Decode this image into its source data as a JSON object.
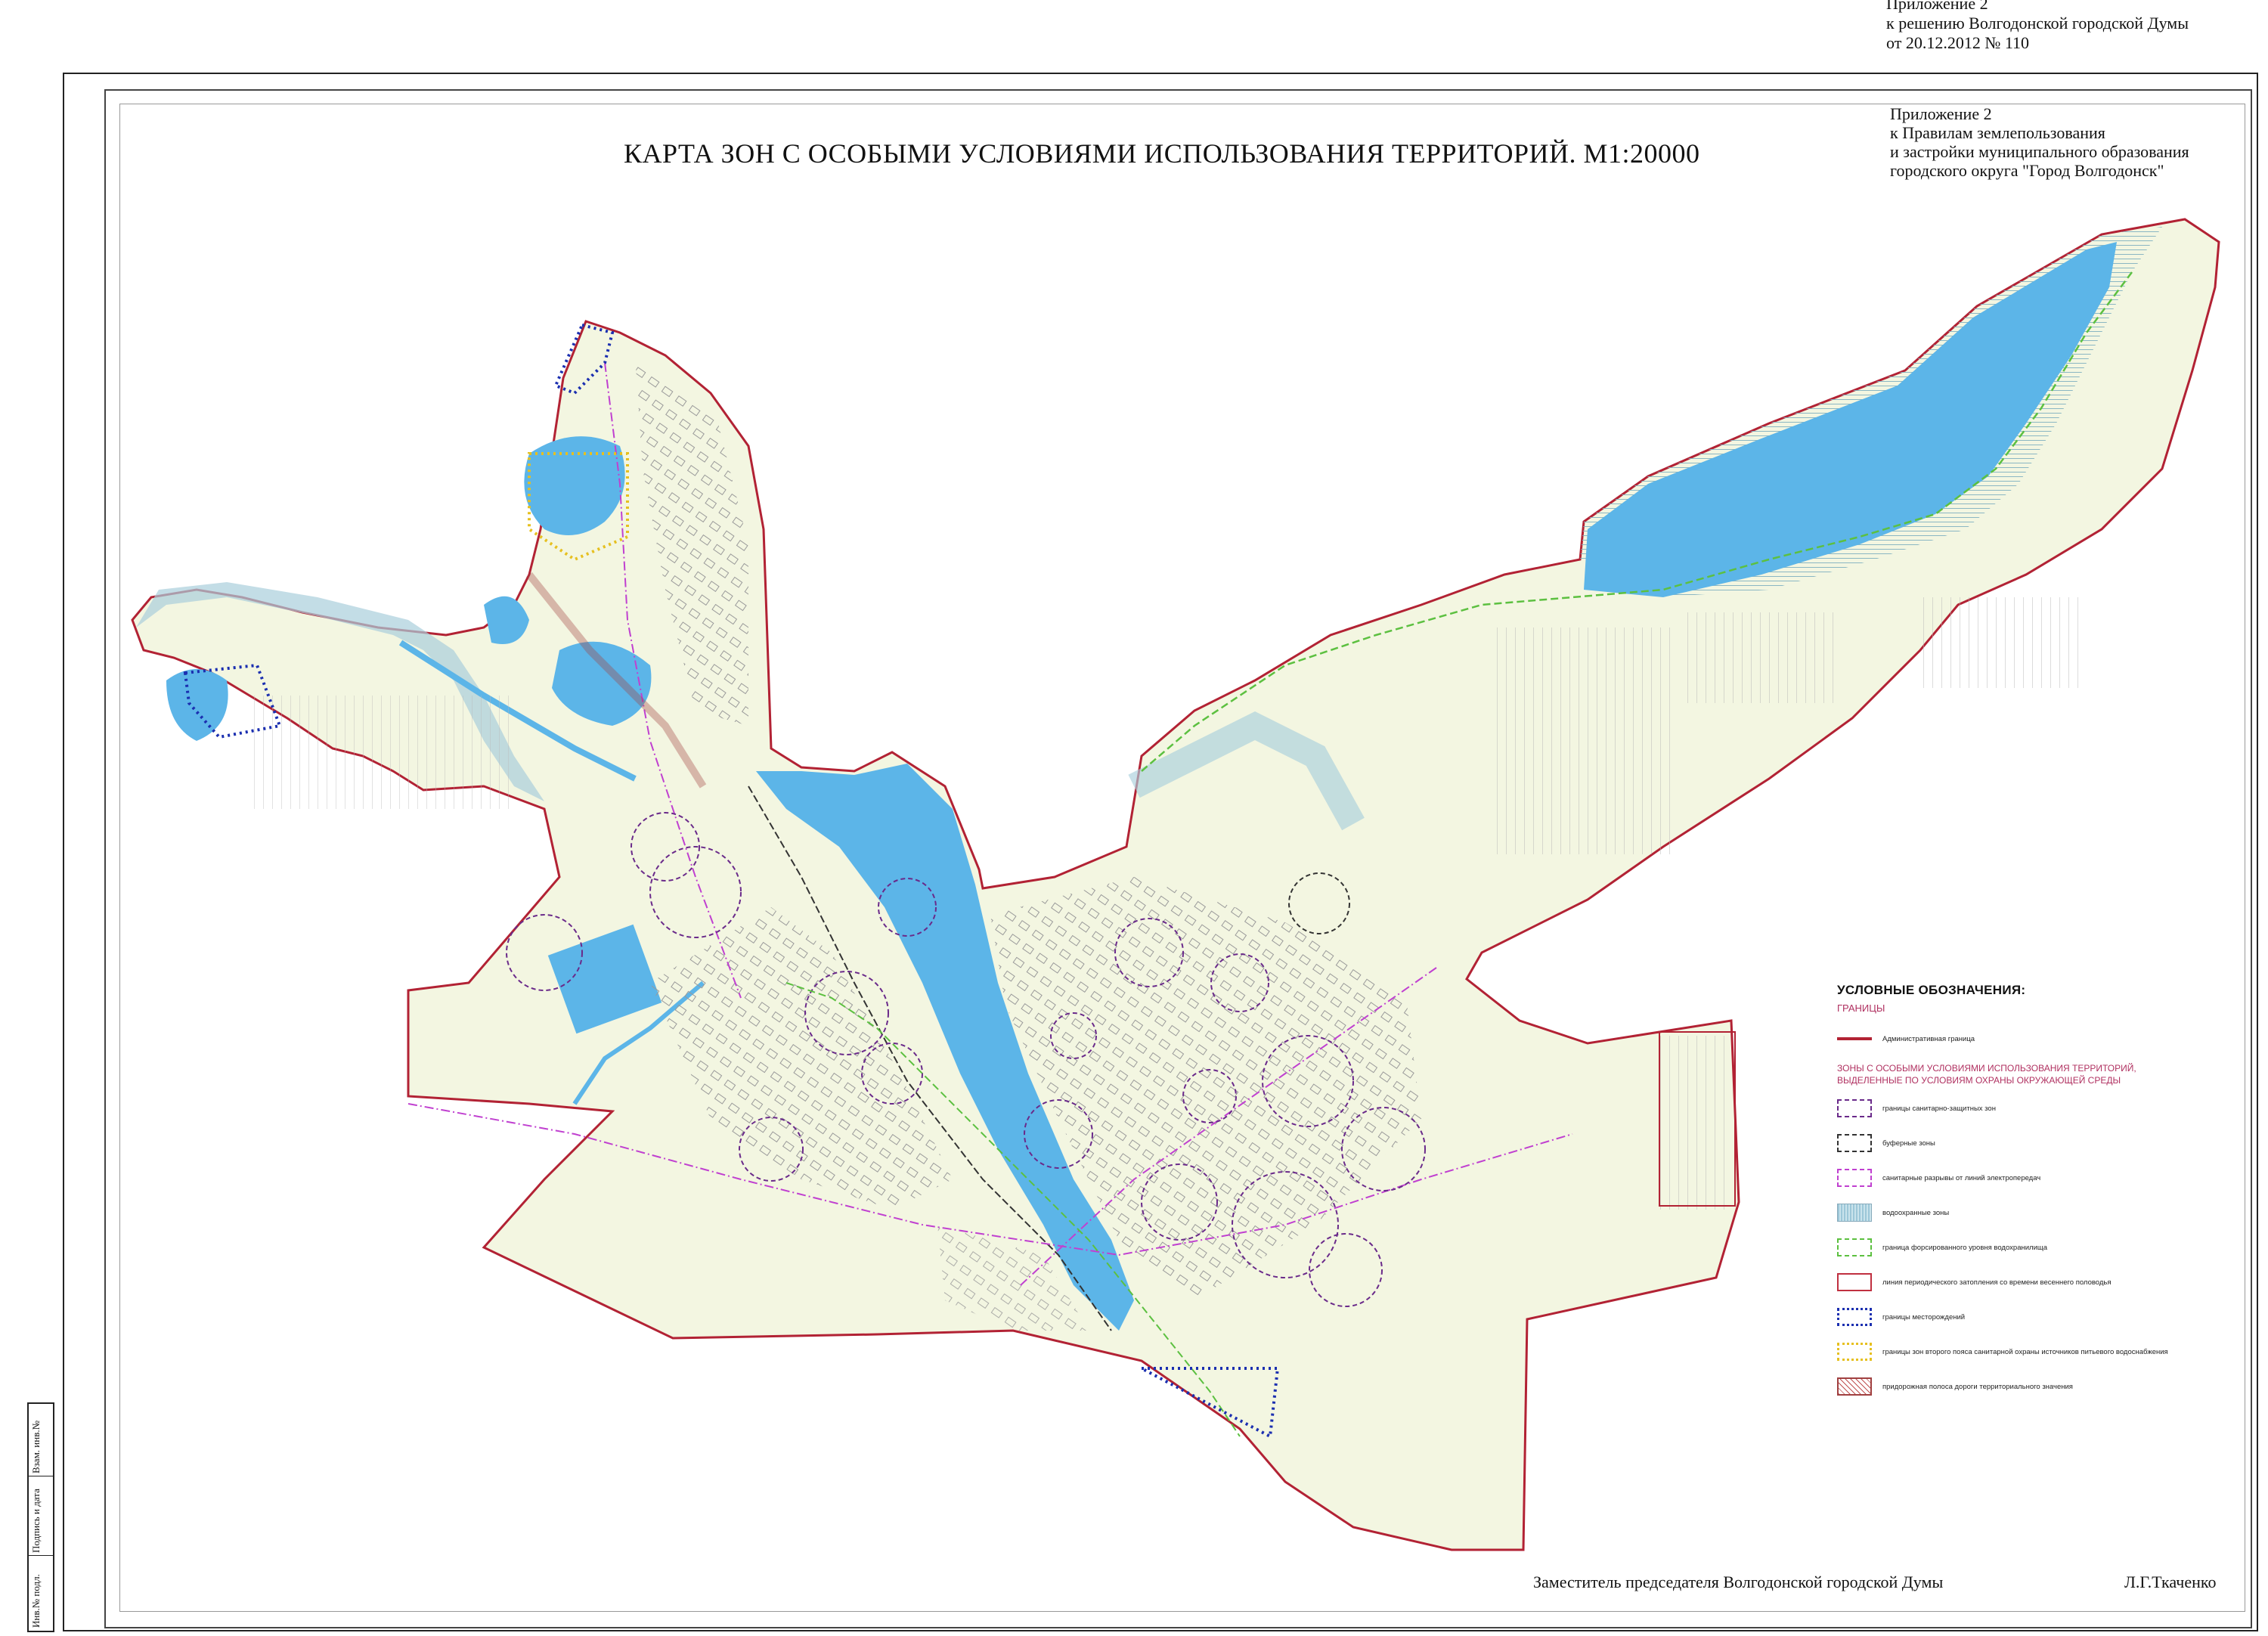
{
  "top_annex": {
    "line1": "Приложение 2",
    "line2": "к решению Волгодонской городской Думы",
    "line3": "от 20.12.2012 № 110"
  },
  "title": "КАРТА  ЗОН С ОСОБЫМИ УСЛОВИЯМИ ИСПОЛЬЗОВАНИЯ ТЕРРИТОРИЙ. М1:20000",
  "annex_rules": {
    "line1": "Приложение 2",
    "line2": "к Правилам землепользования",
    "line3": "и застройки муниципального образования",
    "line4": "городского округа \"Город Волгодонск\""
  },
  "stamp": {
    "cell1": "Взам. инв.№",
    "cell2": "Подпись и дата",
    "cell3": "Инв.№ подл."
  },
  "legend": {
    "title": "УСЛОВНЫЕ ОБОЗНАЧЕНИЯ:",
    "subtitle": "ГРАНИЦЫ",
    "admin_label": "Административная граница",
    "section": "ЗОНЫ С ОСОБЫМИ УСЛОВИЯМИ ИСПОЛЬЗОВАНИЯ ТЕРРИТОРИЙ, ВЫДЕЛЕННЫЕ ПО УСЛОВИЯМ ОХРАНЫ ОКРУЖАЮЩЕЙ СРЕДЫ",
    "items": [
      "границы санитарно-защитных зон",
      "буферные зоны",
      "санитарные разрывы от линий электропередач",
      "водоохранные зоны",
      "граница форсированного уровня водохранилища",
      "линия периодического затопления со времени весеннего половодья",
      "границы месторождений",
      "границы зон второго пояса санитарной охраны источников питьевого водоснабжения",
      "придорожная полоса дороги территориального значения"
    ]
  },
  "signature": "Заместитель председателя Волгодонской городской Думы",
  "signer": "Л.Г.Ткаченко",
  "colors": {
    "land": "#f3f6e1",
    "water": "#5cb5e8",
    "water_zone": "#a9cfdc",
    "admin_border": "#b22234",
    "szz": "#6a2a8a",
    "power": "#c040d0",
    "flood": "#5cc040",
    "deposit": "#1b2fb0",
    "sanitary": "#e6c020",
    "road": "#a04040"
  }
}
